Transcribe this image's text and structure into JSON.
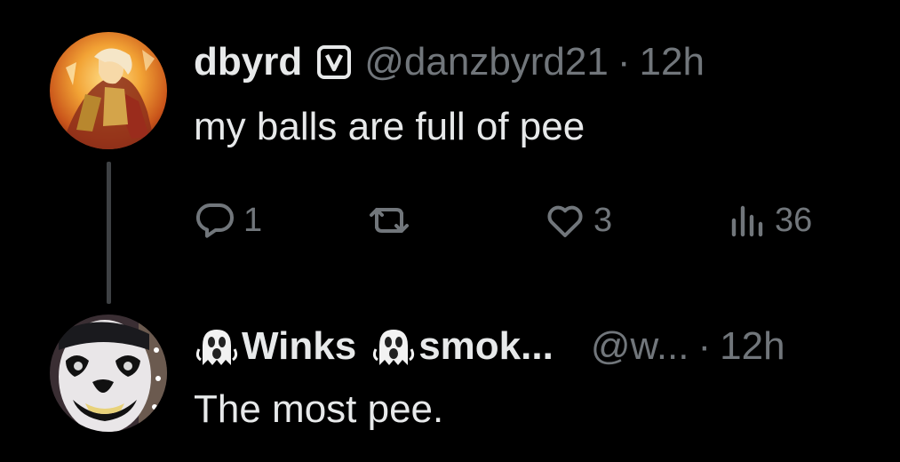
{
  "tweets": [
    {
      "name": "dbyrd",
      "badge": "verified-square-icon",
      "handle": "@danzbyrd21",
      "separator": "·",
      "time": "12h",
      "text": "my balls are full of pee",
      "actions": {
        "reply_count": "1",
        "retweet_count": "",
        "like_count": "3",
        "view_count": "36"
      }
    },
    {
      "name_parts": [
        "Winks",
        "smok..."
      ],
      "name_icons": [
        "ghost-icon",
        "ghost-icon"
      ],
      "handle": "@w...",
      "separator": "·",
      "time": "12h",
      "text": "The most pee."
    }
  ],
  "colors": {
    "background": "#000000",
    "primary_text": "#e7e9ea",
    "secondary_text": "#71767b",
    "thread_line": "#3e4144"
  }
}
